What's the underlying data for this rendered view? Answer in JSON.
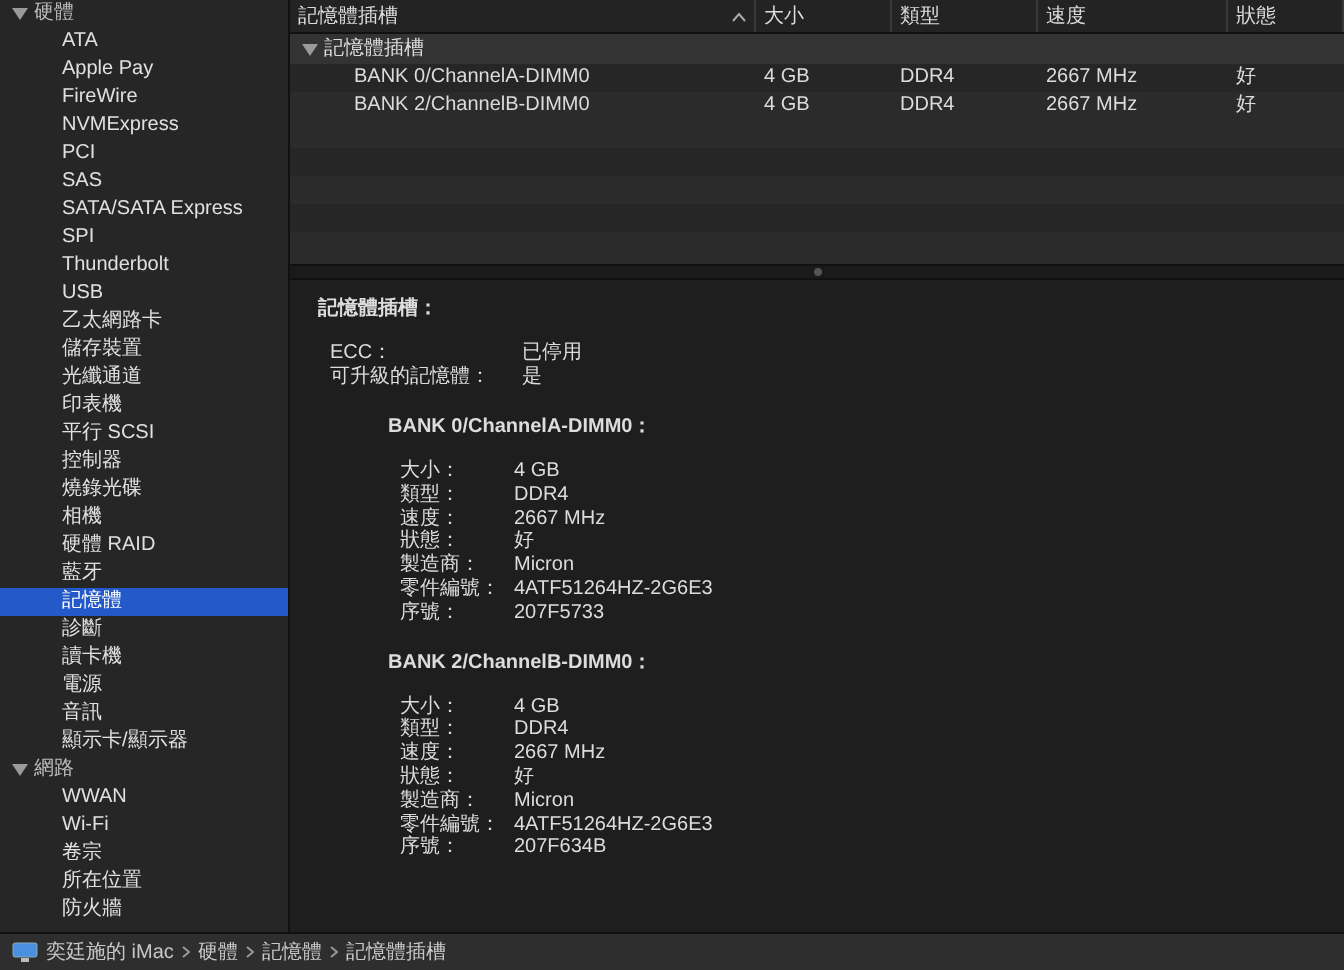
{
  "sidebar": {
    "sections": [
      {
        "label": "硬體",
        "expanded": true,
        "items": [
          {
            "label": "ATA",
            "selected": false
          },
          {
            "label": "Apple Pay",
            "selected": false
          },
          {
            "label": "FireWire",
            "selected": false
          },
          {
            "label": "NVMExpress",
            "selected": false
          },
          {
            "label": "PCI",
            "selected": false
          },
          {
            "label": "SAS",
            "selected": false
          },
          {
            "label": "SATA/SATA Express",
            "selected": false
          },
          {
            "label": "SPI",
            "selected": false
          },
          {
            "label": "Thunderbolt",
            "selected": false
          },
          {
            "label": "USB",
            "selected": false
          },
          {
            "label": "乙太網路卡",
            "selected": false
          },
          {
            "label": "儲存裝置",
            "selected": false
          },
          {
            "label": "光纖通道",
            "selected": false
          },
          {
            "label": "印表機",
            "selected": false
          },
          {
            "label": "平行 SCSI",
            "selected": false
          },
          {
            "label": "控制器",
            "selected": false
          },
          {
            "label": "燒錄光碟",
            "selected": false
          },
          {
            "label": "相機",
            "selected": false
          },
          {
            "label": "硬體 RAID",
            "selected": false
          },
          {
            "label": "藍牙",
            "selected": false
          },
          {
            "label": "記憶體",
            "selected": true
          },
          {
            "label": "診斷",
            "selected": false
          },
          {
            "label": "讀卡機",
            "selected": false
          },
          {
            "label": "電源",
            "selected": false
          },
          {
            "label": "音訊",
            "selected": false
          },
          {
            "label": "顯示卡/顯示器",
            "selected": false
          }
        ]
      },
      {
        "label": "網路",
        "expanded": true,
        "items": [
          {
            "label": "WWAN",
            "selected": false
          },
          {
            "label": "Wi-Fi",
            "selected": false
          },
          {
            "label": "卷宗",
            "selected": false
          },
          {
            "label": "所在位置",
            "selected": false
          },
          {
            "label": "防火牆",
            "selected": false
          }
        ]
      }
    ]
  },
  "table": {
    "columns": [
      {
        "label": "記憶體插槽",
        "sorted": true
      },
      {
        "label": "大小",
        "sorted": false
      },
      {
        "label": "類型",
        "sorted": false
      },
      {
        "label": "速度",
        "sorted": false
      },
      {
        "label": "狀態",
        "sorted": false
      }
    ],
    "group": {
      "label": "記憶體插槽",
      "expanded": true,
      "rows": [
        [
          "BANK 0/ChannelA-DIMM0",
          "4 GB",
          "DDR4",
          "2667 MHz",
          "好"
        ],
        [
          "BANK 2/ChannelB-DIMM0",
          "4 GB",
          "DDR4",
          "2667 MHz",
          "好"
        ]
      ]
    }
  },
  "detail": {
    "title": "記憶體插槽：",
    "fields": [
      {
        "label": "ECC：",
        "value": "已停用"
      },
      {
        "label": "可升級的記憶體：",
        "value": "是"
      }
    ],
    "banks": [
      {
        "title": "BANK 0/ChannelA-DIMM0：",
        "fields": [
          {
            "label": "大小：",
            "value": "4 GB"
          },
          {
            "label": "類型：",
            "value": "DDR4"
          },
          {
            "label": "速度：",
            "value": "2667 MHz"
          },
          {
            "label": "狀態：",
            "value": "好"
          },
          {
            "label": "製造商：",
            "value": "Micron"
          },
          {
            "label": "零件編號：",
            "value": "4ATF51264HZ-2G6E3"
          },
          {
            "label": "序號：",
            "value": "207F5733"
          }
        ]
      },
      {
        "title": "BANK 2/ChannelB-DIMM0：",
        "fields": [
          {
            "label": "大小：",
            "value": "4 GB"
          },
          {
            "label": "類型：",
            "value": "DDR4"
          },
          {
            "label": "速度：",
            "value": "2667 MHz"
          },
          {
            "label": "狀態：",
            "value": "好"
          },
          {
            "label": "製造商：",
            "value": "Micron"
          },
          {
            "label": "零件編號：",
            "value": "4ATF51264HZ-2G6E3"
          },
          {
            "label": "序號：",
            "value": "207F634B"
          }
        ]
      }
    ]
  },
  "status_bar": {
    "breadcrumb": [
      "奕廷施的 iMac",
      "硬體",
      "記憶體",
      "記憶體插槽"
    ]
  }
}
